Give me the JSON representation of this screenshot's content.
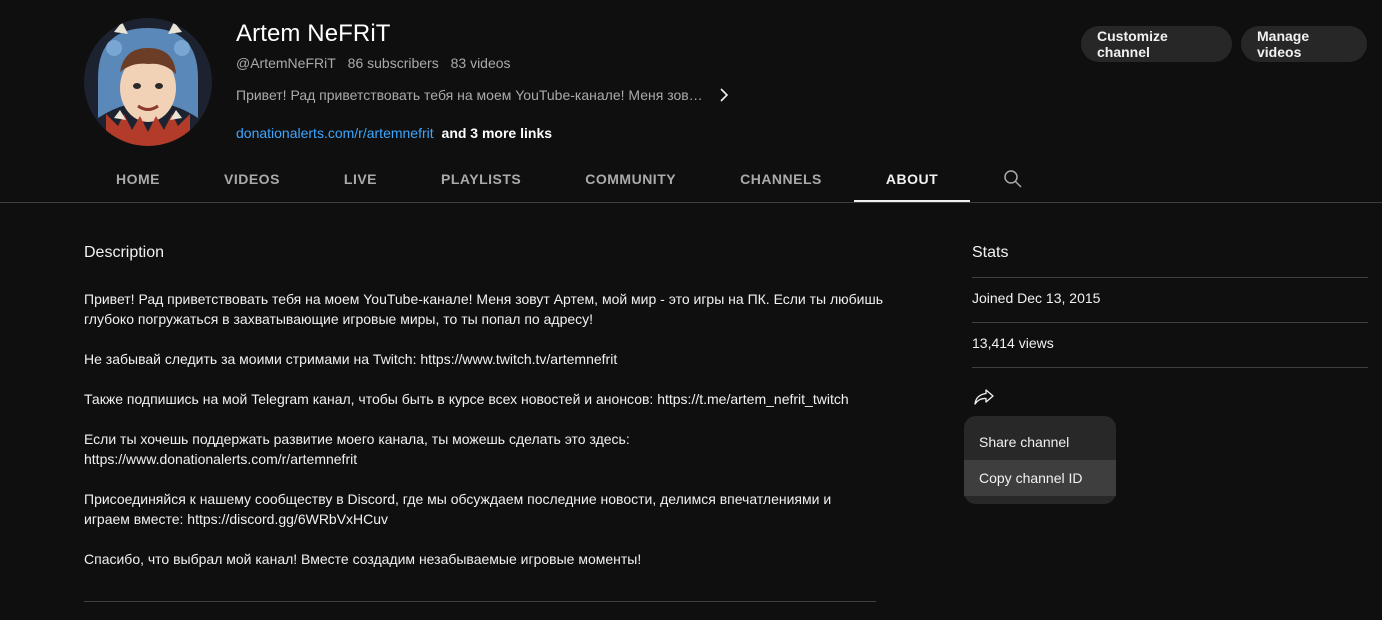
{
  "channel": {
    "name": "Artem NeFRiT",
    "handle": "@ArtemNeFRiT",
    "subscribers": "86 subscribers",
    "videos": "83 videos",
    "short_description": "Привет! Рад приветствовать тебя на моем YouTube-канале! Меня зов…",
    "link_text": "donationalerts.com/r/artemnefrit",
    "more_links": "and 3 more links"
  },
  "buttons": {
    "customize": "Customize channel",
    "manage": "Manage videos"
  },
  "tabs": [
    "HOME",
    "VIDEOS",
    "LIVE",
    "PLAYLISTS",
    "COMMUNITY",
    "CHANNELS",
    "ABOUT"
  ],
  "active_tab": "ABOUT",
  "description": {
    "heading": "Description",
    "paragraphs": [
      "Привет! Рад приветствовать тебя на моем YouTube-канале! Меня зовут Артем, мой мир - это игры на ПК. Если ты любишь глубоко погружаться в захватывающие игровые миры, то ты попал по адресу!",
      "Не забывай следить за моими стримами на Twitch: https://www.twitch.tv/artemnefrit",
      "Также подпишись на мой Telegram канал, чтобы быть в курсе всех новостей и анонсов: https://t.me/artem_nefrit_twitch",
      "Если ты хочешь поддержать развитие моего канала, ты можешь сделать это здесь: https://www.donationalerts.com/r/artemnefrit",
      "Присоединяйся к нашему сообществу в Discord, где мы обсуждаем последние новости, делимся впечатлениями и играем вместе: https://discord.gg/6WRbVxHCuv",
      "Спасибо, что выбрал мой канал! Вместе создадим незабываемые игровые моменты!"
    ]
  },
  "stats": {
    "heading": "Stats",
    "joined": "Joined Dec 13, 2015",
    "views": "13,414 views"
  },
  "share_menu": {
    "items": [
      "Share channel",
      "Copy channel ID"
    ],
    "hovered": "Copy channel ID"
  },
  "icons": {
    "search": "search-icon",
    "chevron": "chevron-right-icon",
    "share": "share-icon",
    "avatar": "avatar"
  },
  "colors": {
    "background": "#0f0f0f",
    "link": "#3ea6ff",
    "button_bg": "#272727",
    "menu_bg": "#282828"
  }
}
